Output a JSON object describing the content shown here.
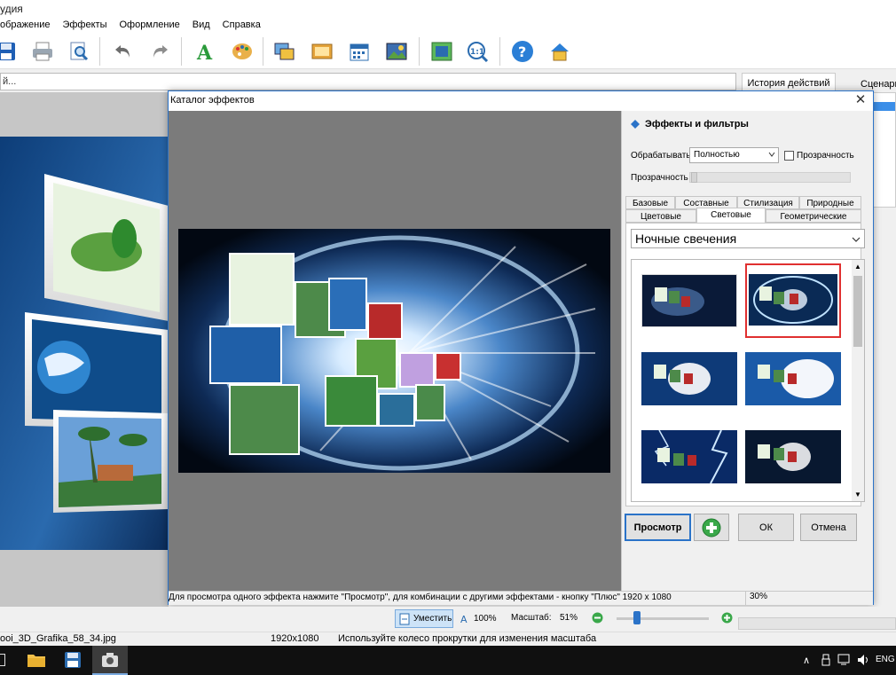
{
  "app": {
    "title_fragment": "удия",
    "menu": [
      "ображение",
      "Эффекты",
      "Оформление",
      "Вид",
      "Справка"
    ],
    "path_text": "й...",
    "right_tabs": [
      "История действий",
      "Сценари"
    ]
  },
  "dialog": {
    "title": "Каталог эффектов",
    "close_glyph": "✕",
    "panel_title": "Эффекты и фильтры",
    "process_label": "Обрабатывать",
    "process_value": "Полностью",
    "transparency_checkbox_label": "Прозрачность",
    "transparency_label": "Прозрачность",
    "tabs_row1": [
      "Базовые",
      "Составные",
      "Стилизация",
      "Природные"
    ],
    "tabs_row2": [
      "Цветовые",
      "Световые",
      "Геометрические"
    ],
    "active_tab": "Световые",
    "category_value": "Ночные свечения",
    "buttons": {
      "preview": "Просмотр",
      "ok": "ОК",
      "cancel": "Отмена"
    },
    "status_hint": "Для просмотра одного эффекта нажмите \"Просмотр\", для комбинации с другими эффектами - кнопку \"Плюс\"  1920 x 1080",
    "status_zoom": "30%"
  },
  "bottom": {
    "fit_label": "Уместить",
    "zoom_100": "100%",
    "scale_label": "Масштаб:",
    "scale_value": "51%",
    "scale_fraction": 0.2
  },
  "status": {
    "filename": "ooi_3D_Grafika_58_34.jpg",
    "dimensions": "1920x1080",
    "hint": "Используйте колесо прокрутки для изменения масштаба"
  },
  "taskbar": {
    "lang": "ENG"
  },
  "colors": {
    "accent": "#2b73c8",
    "selected_border": "#e03030",
    "taskbar": "#101010"
  }
}
